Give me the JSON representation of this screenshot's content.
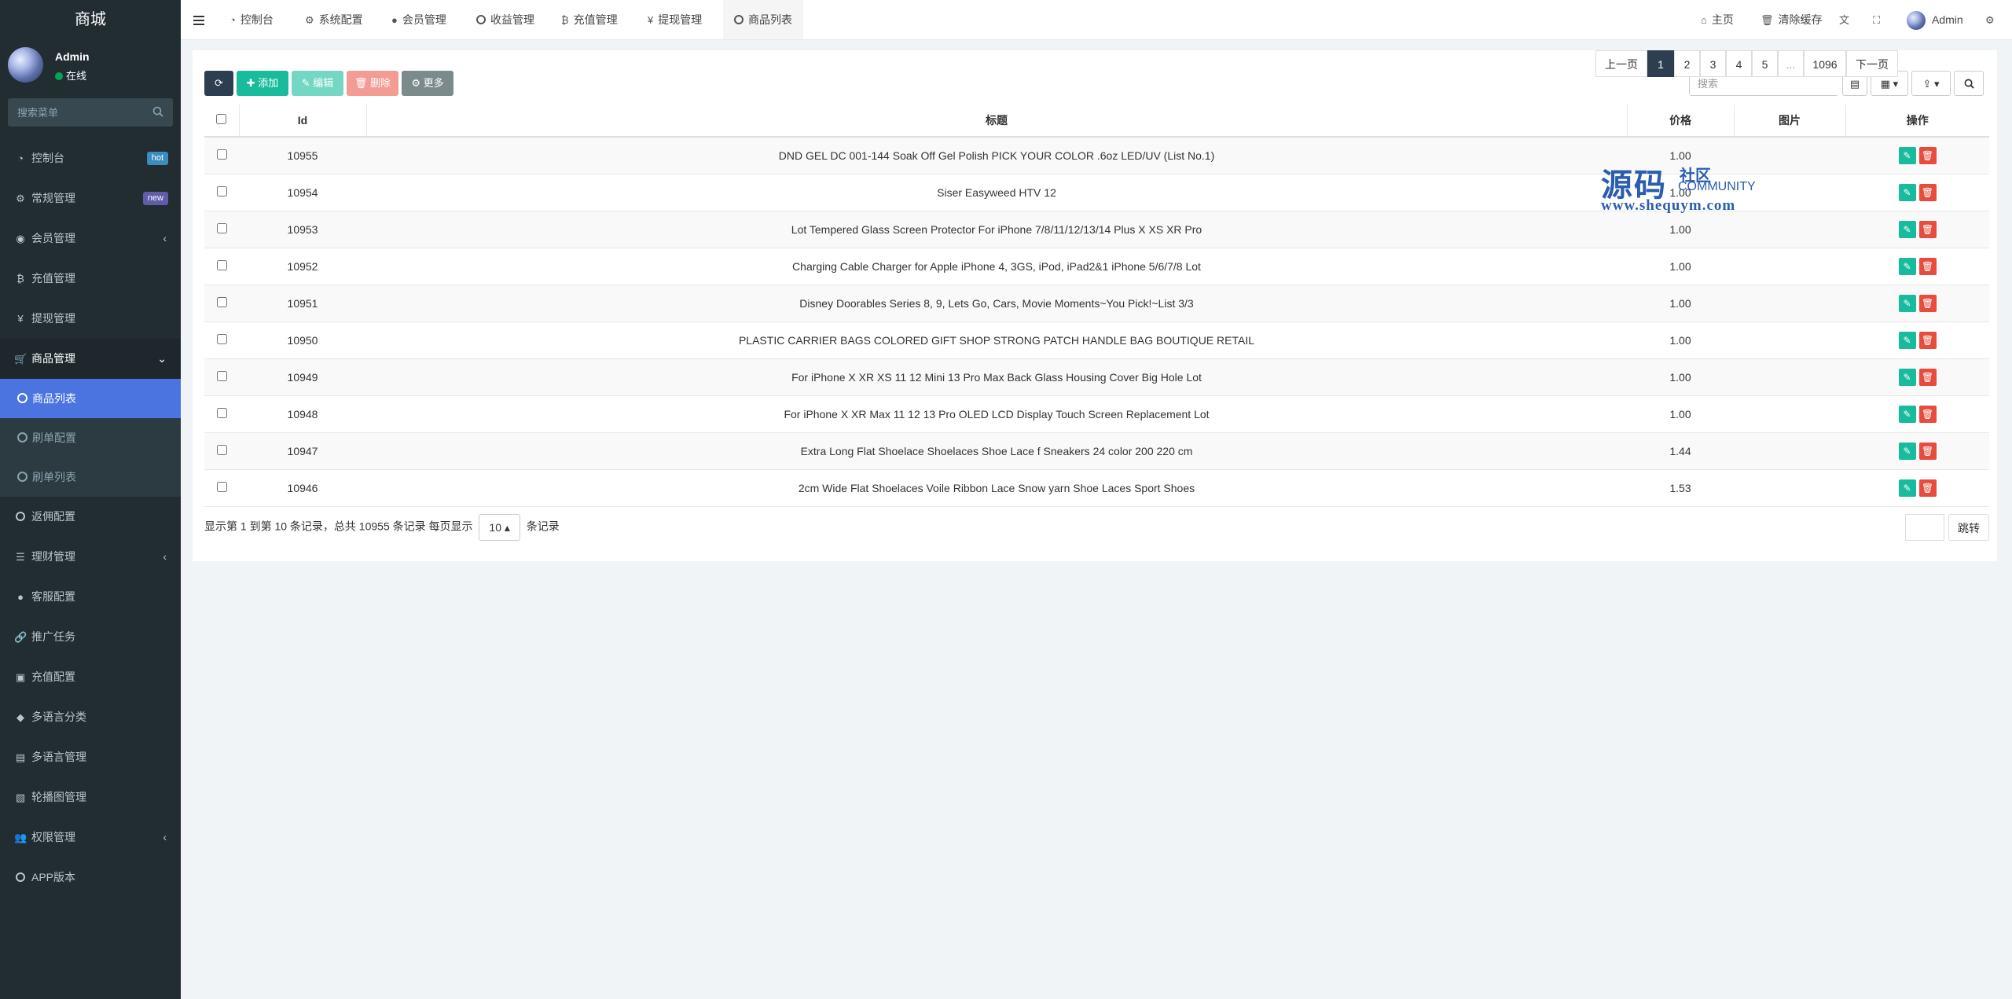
{
  "brand": "商城",
  "user": {
    "name": "Admin",
    "status": "在线"
  },
  "sidebar": {
    "search_placeholder": "搜索菜单",
    "items": [
      {
        "label": "控制台",
        "icon": "dashboard-icon",
        "badge": "hot"
      },
      {
        "label": "常规管理",
        "icon": "cogs-icon",
        "badge": "new"
      },
      {
        "label": "会员管理",
        "icon": "user-circle-icon",
        "arrow": "‹"
      },
      {
        "label": "充值管理",
        "icon": "bitcoin-icon"
      },
      {
        "label": "提现管理",
        "icon": "yen-icon"
      },
      {
        "label": "商品管理",
        "icon": "cart-icon",
        "arrow": "⌄"
      }
    ],
    "submenu": [
      {
        "label": "商品列表",
        "active": true
      },
      {
        "label": "刷单配置"
      },
      {
        "label": "刷单列表"
      }
    ],
    "items2": [
      {
        "label": "返佣配置",
        "icon": "circle-o-icon"
      },
      {
        "label": "理财管理",
        "icon": "list-icon",
        "arrow": "‹"
      },
      {
        "label": "客服配置",
        "icon": "headset-icon"
      },
      {
        "label": "推广任务",
        "icon": "link-icon"
      },
      {
        "label": "充值配置",
        "icon": "image-icon"
      },
      {
        "label": "多语言分类",
        "icon": "tag-icon"
      },
      {
        "label": "多语言管理",
        "icon": "language-icon"
      },
      {
        "label": "轮播图管理",
        "icon": "slides-icon"
      },
      {
        "label": "权限管理",
        "icon": "group-icon",
        "arrow": "‹"
      },
      {
        "label": "APP版本",
        "icon": "circle-o-icon"
      }
    ]
  },
  "topnav": {
    "tabs": [
      "控制台",
      "系统配置",
      "会员管理",
      "收益管理",
      "充值管理",
      "提现管理",
      "商品列表"
    ],
    "home": "主页",
    "clear_cache": "清除缓存",
    "admin": "Admin"
  },
  "toolbar": {
    "add": "添加",
    "edit": "编辑",
    "delete": "删除",
    "more": "更多",
    "search_placeholder": "搜索"
  },
  "table": {
    "columns": [
      "Id",
      "标题",
      "价格",
      "图片",
      "操作"
    ],
    "rows": [
      {
        "id": "10955",
        "title": "DND GEL DC 001-144 Soak Off Gel Polish PICK YOUR COLOR .6oz LED/UV (List No.1)",
        "price": "1.00"
      },
      {
        "id": "10954",
        "title": "Siser Easyweed HTV 12",
        "price": "1.00"
      },
      {
        "id": "10953",
        "title": "Lot Tempered Glass Screen Protector For iPhone 7/8/11/12/13/14 Plus X XS XR Pro",
        "price": "1.00"
      },
      {
        "id": "10952",
        "title": "Charging Cable Charger for Apple iPhone 4, 3GS, iPod, iPad2&1 iPhone 5/6/7/8 Lot",
        "price": "1.00"
      },
      {
        "id": "10951",
        "title": "Disney Doorables Series 8, 9, Lets Go, Cars, Movie Moments~You Pick!~List 3/3",
        "price": "1.00"
      },
      {
        "id": "10950",
        "title": "PLASTIC CARRIER BAGS COLORED GIFT SHOP STRONG PATCH HANDLE BAG BOUTIQUE RETAIL",
        "price": "1.00"
      },
      {
        "id": "10949",
        "title": "For iPhone X XR XS 11 12 Mini 13 Pro Max Back Glass Housing Cover Big Hole Lot",
        "price": "1.00"
      },
      {
        "id": "10948",
        "title": "For iPhone X XR Max 11 12 13 Pro OLED LCD Display Touch Screen Replacement Lot",
        "price": "1.00"
      },
      {
        "id": "10947",
        "title": "Extra Long Flat Shoelace Shoelaces Shoe Lace f Sneakers 24 color 200 220 cm",
        "price": "1.44"
      },
      {
        "id": "10946",
        "title": "2cm Wide Flat Shoelaces Voile Ribbon Lace Snow yarn Shoe Laces Sport Shoes",
        "price": "1.53"
      }
    ]
  },
  "pagination": {
    "info_before": "显示第 1 到第 10 条记录，总共 10955 条记录 每页显示",
    "page_size": "10",
    "info_after": "条记录",
    "prev": "上一页",
    "pages": [
      "1",
      "2",
      "3",
      "4",
      "5",
      "...",
      "1096"
    ],
    "next": "下一页",
    "jump": "跳转"
  },
  "watermark": {
    "big": "源码",
    "small": "社区",
    "community": "COMMUNITY",
    "url": "www.shequym.com"
  },
  "colors": {
    "sidebar": "#222d32",
    "active": "#4c74e1",
    "success": "#18bc9c",
    "danger": "#e74c3c",
    "primary_dark": "#2c3e50"
  }
}
